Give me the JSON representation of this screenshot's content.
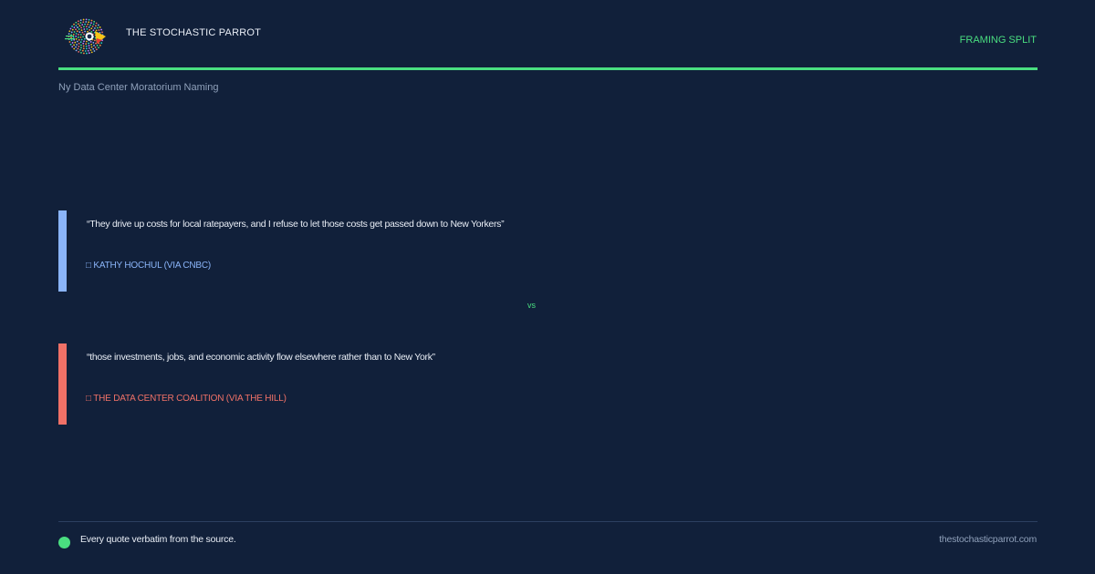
{
  "header": {
    "brand": "THE STOCHASTIC PARROT",
    "tag": "FRAMING SPLIT",
    "subtitle": "Ny Data Center Moratorium Naming",
    "logo_icon": "parrot-logo-icon"
  },
  "quotes": [
    {
      "text": "“They drive up costs for local ratepayers, and I refuse to let those costs get passed down to New Yorkers”",
      "attribution": "□ KATHY HOCHUL (VIA CNBC)",
      "color": "#8ab4f8"
    },
    {
      "text": "“those investments, jobs, and economic activity flow elsewhere rather than to New York”",
      "attribution": "□ THE DATA CENTER COALITION (VIA THE HILL)",
      "color": "#f07167"
    }
  ],
  "separator": "vs",
  "footer": {
    "note": "Every quote verbatim from the source.",
    "site": "thestochasticparrot.com"
  },
  "colors": {
    "background": "#11203a",
    "accent": "#4ade80",
    "muted": "#8fa0ba"
  }
}
